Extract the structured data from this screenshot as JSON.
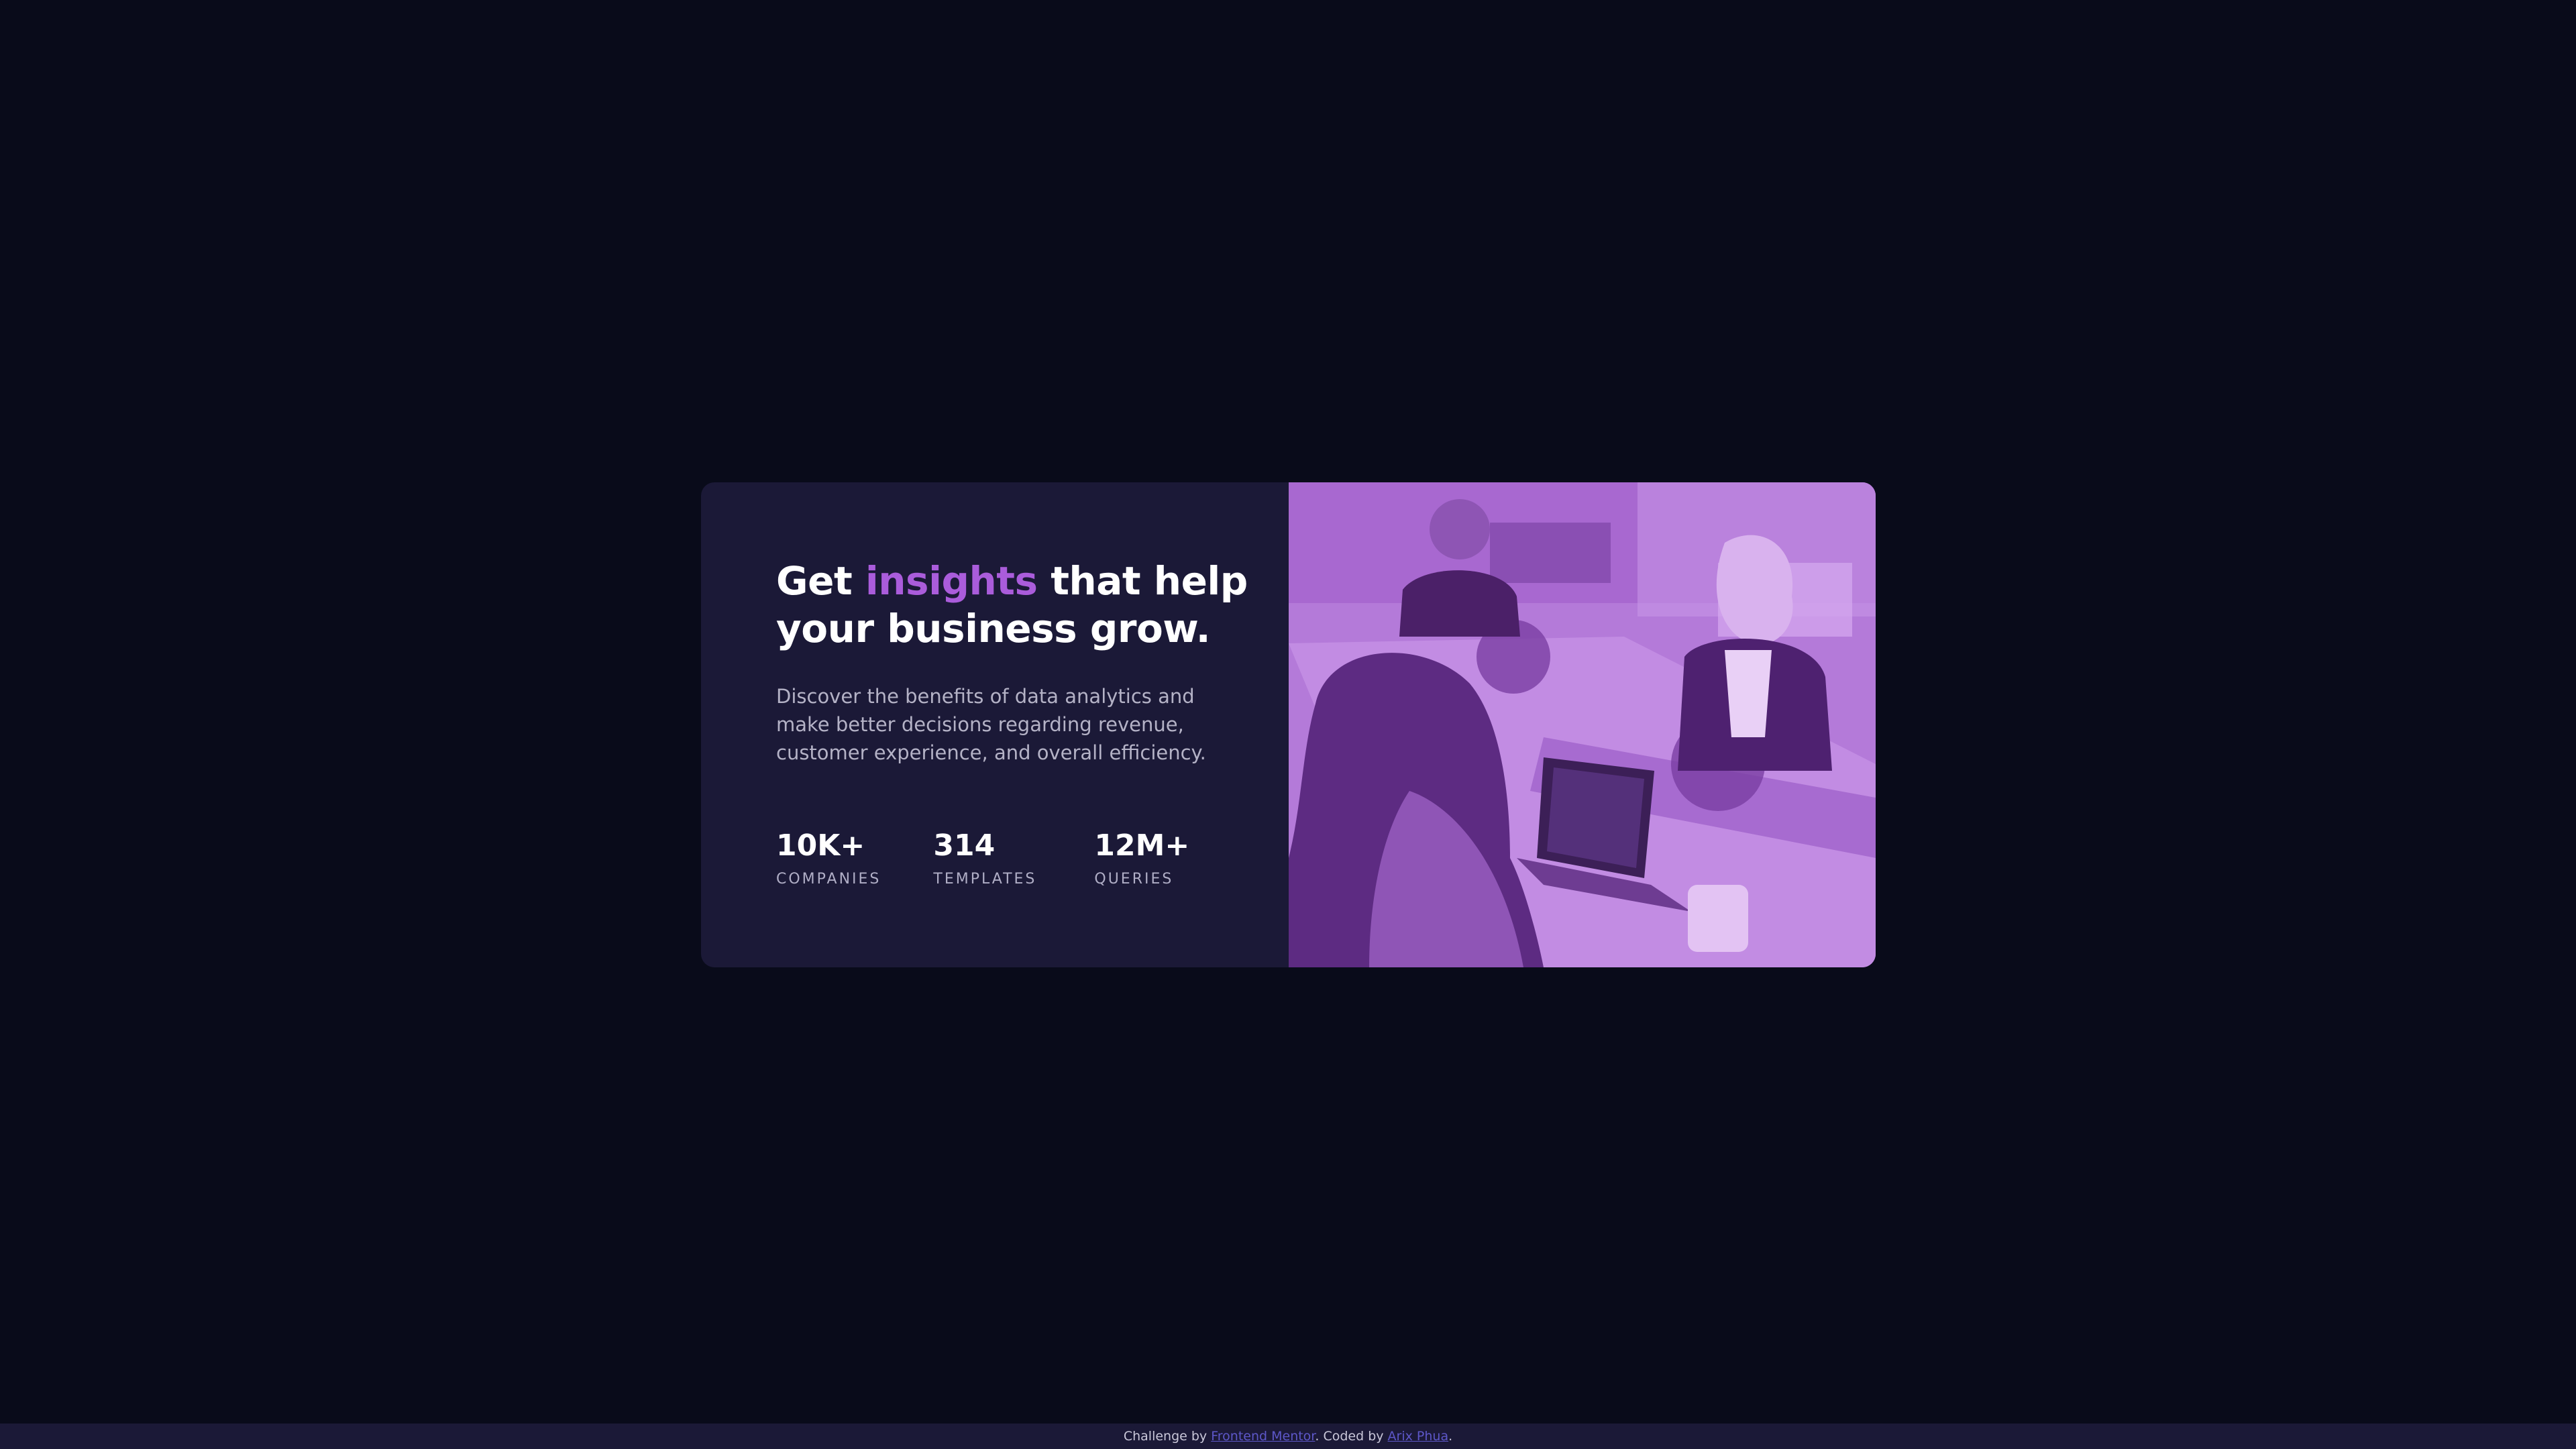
{
  "card": {
    "headline": {
      "pre": "Get ",
      "accent": "insights",
      "post": " that help your business grow."
    },
    "description": "Discover the benefits of data analytics and make better decisions regarding revenue, customer experience, and overall efficiency.",
    "stats": [
      {
        "value": "10K+",
        "label": "COMPANIES"
      },
      {
        "value": "314",
        "label": "TEMPLATES"
      },
      {
        "value": "12M+",
        "label": "QUERIES"
      }
    ]
  },
  "footer": {
    "prefix": "Challenge by ",
    "link1": "Frontend Mentor",
    "middle": ". Coded by ",
    "link2": "Arix Phua",
    "suffix": "."
  },
  "colors": {
    "background": "#090b1a",
    "card": "#1b1937",
    "accent": "#aa5cdb",
    "image_tint": "#aa5cdb",
    "link": "#5d57c8"
  }
}
